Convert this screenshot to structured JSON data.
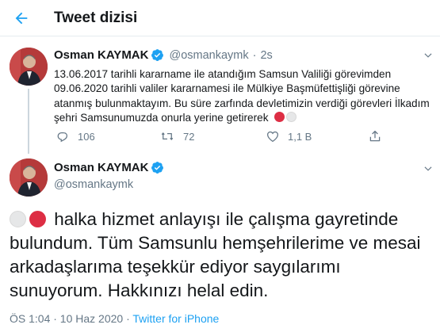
{
  "header": {
    "title": "Tweet dizisi"
  },
  "tweet1": {
    "name": "Osman KAYMAK",
    "handle": "@osmankaymk",
    "separator": "·",
    "time": "2s",
    "text": "13.06.2017 tarihli kararname ile atandığım Samsun Valiliği görevimden 09.06.2020 tarihli valiler kararnamesi  ile Mülkiye Başmüfettişliği görevine atanmış bulunmaktayım. Bu süre zarfında devletimizin verdiği görevleri İlkadım şehri Samsunumuzda onurla yerine getirerek",
    "actions": {
      "replies": "106",
      "retweets": "72",
      "likes": "1,1 B"
    }
  },
  "tweet2": {
    "name": "Osman KAYMAK",
    "handle": "@osmankaymk",
    "text": "halka hizmet anlayışı ile çalışma gayretinde bulundum. Tüm Samsunlu hemşehrilerime ve mesai arkadaşlarıma teşekkür ediyor saygılarımı sunuyorum. Hakkınızı helal edin.",
    "timestamp": "ÖS 1:04 · 10 Haz 2020 · ",
    "source": "Twitter for iPhone"
  },
  "colors": {
    "accent": "#1da1f2",
    "verified": "#1da1f2",
    "secondary_text": "#657786",
    "emoji_red": "#dd2e44",
    "emoji_white": "#e6e7e8"
  },
  "icons": [
    "back-arrow-icon",
    "verified-badge-icon",
    "chevron-down-icon",
    "reply-icon",
    "retweet-icon",
    "like-icon",
    "share-icon"
  ]
}
